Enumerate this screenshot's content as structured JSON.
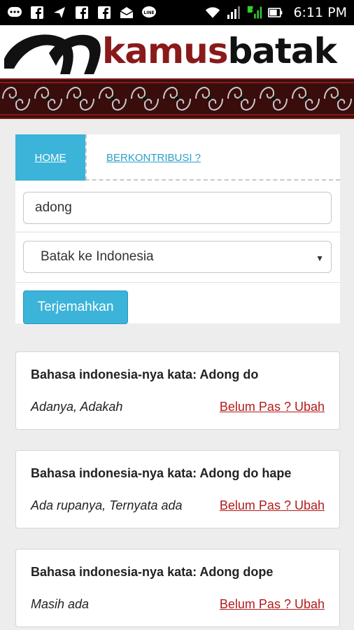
{
  "status_bar": {
    "time": "6:11 PM",
    "left_icons": [
      "messages-icon",
      "facebook-icon",
      "send-icon",
      "facebook-icon",
      "facebook-icon",
      "mail-icon",
      "line-icon"
    ],
    "right_icons": [
      "wifi-icon",
      "signal-icon",
      "signal-2-icon",
      "battery-icon"
    ],
    "sim_badge": "2"
  },
  "header": {
    "logo_kamus": "kamus",
    "logo_batak": "batak",
    "logo_color_dark": "#111111",
    "logo_color_red": "#8a1a1a"
  },
  "tabs": {
    "home": "HOME",
    "contribute": "BERKONTRIBUSI ?"
  },
  "search": {
    "value": "adong"
  },
  "direction_select": {
    "selected": "Batak ke Indonesia"
  },
  "translate_button": "Terjemahkan",
  "results": [
    {
      "title": "Bahasa indonesia-nya kata: Adong do",
      "meaning": "Adanya, Adakah",
      "link": "Belum Pas ? Ubah"
    },
    {
      "title": "Bahasa indonesia-nya kata: Adong do hape",
      "meaning": "Ada rupanya, Ternyata ada",
      "link": "Belum Pas ? Ubah"
    },
    {
      "title": "Bahasa indonesia-nya kata: Adong dope",
      "meaning": "Masih ada",
      "link": "Belum Pas ? Ubah"
    }
  ],
  "colors": {
    "accent": "#3cb3d9",
    "link_red": "#b31b1b",
    "band": "#3a0d0d"
  }
}
